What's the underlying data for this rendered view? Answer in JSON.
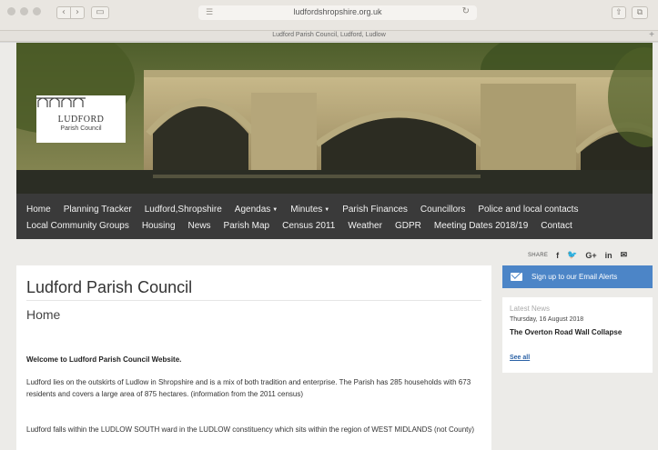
{
  "browser": {
    "url": "ludfordshropshire.org.uk",
    "tab_title": "Ludford Parish Council, Ludford, Ludlow",
    "back_icon": "‹",
    "forward_icon": "›",
    "new_tab_icon": "+"
  },
  "logo": {
    "name": "LUDFORD",
    "subtitle": "Parish Council"
  },
  "nav": {
    "row1": [
      {
        "label": "Home"
      },
      {
        "label": "Planning Tracker"
      },
      {
        "label": "Ludford,Shropshire"
      },
      {
        "label": "Agendas",
        "dropdown": true
      },
      {
        "label": "Minutes",
        "dropdown": true
      },
      {
        "label": "Parish Finances"
      },
      {
        "label": "Councillors"
      },
      {
        "label": "Police and local contacts"
      }
    ],
    "row2": [
      {
        "label": "Local Community Groups"
      },
      {
        "label": "Housing"
      },
      {
        "label": "News"
      },
      {
        "label": "Parish Map"
      },
      {
        "label": "Census 2011"
      },
      {
        "label": "Weather"
      },
      {
        "label": "GDPR"
      },
      {
        "label": "Meeting Dates 2018/19"
      },
      {
        "label": "Contact"
      }
    ],
    "caret": "▼"
  },
  "share": {
    "label": "SHARE",
    "icons": [
      {
        "name": "facebook-icon",
        "glyph": "f"
      },
      {
        "name": "twitter-icon",
        "glyph": "🐦"
      },
      {
        "name": "google-plus-icon",
        "glyph": "G+"
      },
      {
        "name": "linkedin-icon",
        "glyph": "in"
      },
      {
        "name": "email-icon",
        "glyph": "✉"
      }
    ]
  },
  "main": {
    "site_title": "Ludford Parish Council",
    "page_title": "Home",
    "welcome": "Welcome to Ludford Parish Council Website.",
    "paragraph1": "Ludford lies on the outskirts of Ludlow in Shropshire and is a mix of both tradition and enterprise. The Parish has 285 households with 673 residents and covers a large area of 875 hectares. (information from the 2011 census)",
    "paragraph2": "Ludford falls within the LUDLOW SOUTH ward in the LUDLOW constituency which sits within the region of WEST MIDLANDS (not County)"
  },
  "sidebar": {
    "signup_label": "Sign up to our Email Alerts",
    "news_heading": "Latest News",
    "news_date": "Thursday, 16 August 2018",
    "news_title": "The Overton Road Wall Collapse",
    "see_all": "See all"
  },
  "colors": {
    "nav_bg": "#3a3a3a",
    "signup_bg": "#4c85c7",
    "link": "#2b62a6"
  }
}
